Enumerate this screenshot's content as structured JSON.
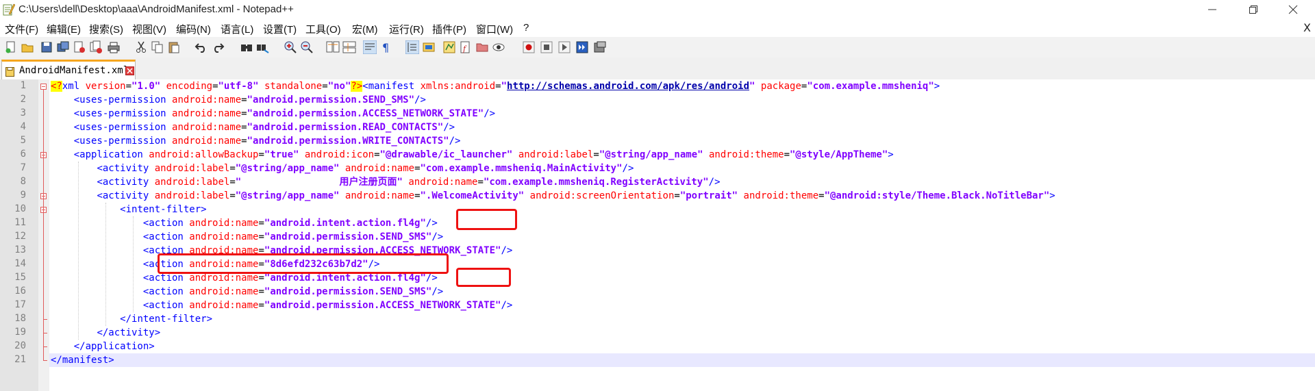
{
  "window": {
    "title": "C:\\Users\\dell\\Desktop\\aaa\\AndroidManifest.xml - Notepad++",
    "app_icon": "notepad-plus-icon"
  },
  "window_controls": [
    "minimize-icon",
    "restore-icon",
    "close-icon"
  ],
  "menu": {
    "items": [
      "文件(F)",
      "编辑(E)",
      "搜索(S)",
      "视图(V)",
      "编码(N)",
      "语言(L)",
      "设置(T)",
      "工具(O)",
      "宏(M)",
      "运行(R)",
      "插件(P)",
      "窗口(W)",
      "?"
    ],
    "close_label": "X"
  },
  "toolbar": {
    "icons": [
      "new-file-icon",
      "open-file-icon",
      "save-icon",
      "save-all-icon",
      "close-icon",
      "close-all-icon",
      "print-icon",
      "cut-icon",
      "copy-icon",
      "paste-icon",
      "undo-icon",
      "redo-icon",
      "find-icon",
      "replace-icon",
      "zoom-in-icon",
      "zoom-out-icon",
      "sync-vertical-icon",
      "sync-horizontal-icon",
      "word-wrap-icon",
      "show-all-chars-icon",
      "indent-guide-icon",
      "user-language-icon",
      "doc-map-icon",
      "function-list-icon",
      "folder-workspace-icon",
      "monitoring-icon",
      "record-macro-icon",
      "stop-macro-icon",
      "play-macro-icon",
      "run-macro-multiple-icon",
      "save-macro-icon"
    ]
  },
  "tab": {
    "label": "AndroidManifest.xml",
    "modified": true,
    "active": true
  },
  "editor": {
    "line_numbers": [
      "1",
      "2",
      "3",
      "4",
      "5",
      "6",
      "7",
      "8",
      "9",
      "10",
      "11",
      "12",
      "13",
      "14",
      "15",
      "16",
      "17",
      "18",
      "19",
      "20",
      "21"
    ],
    "current_line": 21,
    "lines": [
      [
        [
          "pi",
          "<?"
        ],
        [
          "b",
          "xml "
        ],
        [
          "a",
          "version"
        ],
        [
          "m",
          "="
        ],
        [
          "v",
          "\"1.0\""
        ],
        [
          "m",
          " "
        ],
        [
          "a",
          "encoding"
        ],
        [
          "m",
          "="
        ],
        [
          "v",
          "\"utf-8\""
        ],
        [
          "m",
          " "
        ],
        [
          "a",
          "standalone"
        ],
        [
          "m",
          "="
        ],
        [
          "v",
          "\"no\""
        ],
        [
          "pi",
          "?>"
        ],
        [
          "b",
          "<manifest "
        ],
        [
          "a",
          "xmlns:android"
        ],
        [
          "m",
          "="
        ],
        [
          "v",
          "\""
        ],
        [
          "u",
          "http://schemas.android.com/apk/res/android"
        ],
        [
          "v",
          "\""
        ],
        [
          "m",
          " "
        ],
        [
          "a",
          "package"
        ],
        [
          "m",
          "="
        ],
        [
          "v",
          "\"com.example.mmsheniq\""
        ],
        [
          "b",
          ">"
        ]
      ],
      [
        [
          "m",
          "    "
        ],
        [
          "b",
          "<uses-permission "
        ],
        [
          "a",
          "android:name"
        ],
        [
          "m",
          "="
        ],
        [
          "v",
          "\"android.permission.SEND_SMS\""
        ],
        [
          "b",
          "/>"
        ]
      ],
      [
        [
          "m",
          "    "
        ],
        [
          "b",
          "<uses-permission "
        ],
        [
          "a",
          "android:name"
        ],
        [
          "m",
          "="
        ],
        [
          "v",
          "\"android.permission.ACCESS_NETWORK_STATE\""
        ],
        [
          "b",
          "/>"
        ]
      ],
      [
        [
          "m",
          "    "
        ],
        [
          "b",
          "<uses-permission "
        ],
        [
          "a",
          "android:name"
        ],
        [
          "m",
          "="
        ],
        [
          "v",
          "\"android.permission.READ_CONTACTS\""
        ],
        [
          "b",
          "/>"
        ]
      ],
      [
        [
          "m",
          "    "
        ],
        [
          "b",
          "<uses-permission "
        ],
        [
          "a",
          "android:name"
        ],
        [
          "m",
          "="
        ],
        [
          "v",
          "\"android.permission.WRITE_CONTACTS\""
        ],
        [
          "b",
          "/>"
        ]
      ],
      [
        [
          "m",
          "    "
        ],
        [
          "b",
          "<application "
        ],
        [
          "a",
          "android:allowBackup"
        ],
        [
          "m",
          "="
        ],
        [
          "v",
          "\"true\""
        ],
        [
          "m",
          " "
        ],
        [
          "a",
          "android:icon"
        ],
        [
          "m",
          "="
        ],
        [
          "v",
          "\"@drawable/ic_launcher\""
        ],
        [
          "m",
          " "
        ],
        [
          "a",
          "android:label"
        ],
        [
          "m",
          "="
        ],
        [
          "v",
          "\"@string/app_name\""
        ],
        [
          "m",
          " "
        ],
        [
          "a",
          "android:theme"
        ],
        [
          "m",
          "="
        ],
        [
          "v",
          "\"@style/AppTheme\""
        ],
        [
          "b",
          ">"
        ]
      ],
      [
        [
          "m",
          "        "
        ],
        [
          "b",
          "<activity "
        ],
        [
          "a",
          "android:label"
        ],
        [
          "m",
          "="
        ],
        [
          "v",
          "\"@string/app_name\""
        ],
        [
          "m",
          " "
        ],
        [
          "a",
          "android:name"
        ],
        [
          "m",
          "="
        ],
        [
          "v",
          "\"com.example.mmsheniq.MainActivity\""
        ],
        [
          "b",
          "/>"
        ]
      ],
      [
        [
          "m",
          "        "
        ],
        [
          "b",
          "<activity "
        ],
        [
          "a",
          "android:label"
        ],
        [
          "m",
          "="
        ],
        [
          "v",
          "\"                 "
        ],
        [
          "t",
          "用户注册页面"
        ],
        [
          "v",
          "\""
        ],
        [
          "m",
          " "
        ],
        [
          "a",
          "android:name"
        ],
        [
          "m",
          "="
        ],
        [
          "v",
          "\"com.example.mmsheniq.RegisterActivity\""
        ],
        [
          "b",
          "/>"
        ]
      ],
      [
        [
          "m",
          "        "
        ],
        [
          "b",
          "<activity "
        ],
        [
          "a",
          "android:label"
        ],
        [
          "m",
          "="
        ],
        [
          "v",
          "\"@string/app_name\""
        ],
        [
          "m",
          " "
        ],
        [
          "a",
          "android:name"
        ],
        [
          "m",
          "="
        ],
        [
          "v",
          "\".WelcomeActivity\""
        ],
        [
          "m",
          " "
        ],
        [
          "a",
          "android:screenOrientation"
        ],
        [
          "m",
          "="
        ],
        [
          "v",
          "\"portrait\""
        ],
        [
          "m",
          " "
        ],
        [
          "a",
          "android:theme"
        ],
        [
          "m",
          "="
        ],
        [
          "v",
          "\"@android:style/Theme.Black.NoTitleBar\""
        ],
        [
          "b",
          ">"
        ]
      ],
      [
        [
          "m",
          "            "
        ],
        [
          "b",
          "<intent-filter>"
        ]
      ],
      [
        [
          "m",
          "                "
        ],
        [
          "b",
          "<action "
        ],
        [
          "a",
          "android:name"
        ],
        [
          "m",
          "="
        ],
        [
          "v",
          "\"android.intent.action.fl4g\""
        ],
        [
          "b",
          "/>"
        ]
      ],
      [
        [
          "m",
          "                "
        ],
        [
          "b",
          "<action "
        ],
        [
          "a",
          "android:name"
        ],
        [
          "m",
          "="
        ],
        [
          "v",
          "\"android.permission.SEND_SMS\""
        ],
        [
          "b",
          "/>"
        ]
      ],
      [
        [
          "m",
          "                "
        ],
        [
          "b",
          "<action "
        ],
        [
          "a",
          "android:name"
        ],
        [
          "m",
          "="
        ],
        [
          "v",
          "\"android.permission.ACCESS_NETWORK_STATE\""
        ],
        [
          "b",
          "/>"
        ]
      ],
      [
        [
          "m",
          "                "
        ],
        [
          "b",
          "<action "
        ],
        [
          "a",
          "android:name"
        ],
        [
          "m",
          "="
        ],
        [
          "v",
          "\"8d6efd232c63b7d2\""
        ],
        [
          "b",
          "/>"
        ]
      ],
      [
        [
          "m",
          "                "
        ],
        [
          "b",
          "<action "
        ],
        [
          "a",
          "android:name"
        ],
        [
          "m",
          "="
        ],
        [
          "v",
          "\"android.intent.action.fl4g\""
        ],
        [
          "b",
          "/>"
        ]
      ],
      [
        [
          "m",
          "                "
        ],
        [
          "b",
          "<action "
        ],
        [
          "a",
          "android:name"
        ],
        [
          "m",
          "="
        ],
        [
          "v",
          "\"android.permission.SEND_SMS\""
        ],
        [
          "b",
          "/>"
        ]
      ],
      [
        [
          "m",
          "                "
        ],
        [
          "b",
          "<action "
        ],
        [
          "a",
          "android:name"
        ],
        [
          "m",
          "="
        ],
        [
          "v",
          "\"android.permission.ACCESS_NETWORK_STATE\""
        ],
        [
          "b",
          "/>"
        ]
      ],
      [
        [
          "m",
          "            "
        ],
        [
          "b",
          "</intent-filter>"
        ]
      ],
      [
        [
          "m",
          "        "
        ],
        [
          "b",
          "</activity>"
        ]
      ],
      [
        [
          "m",
          "    "
        ],
        [
          "b",
          "</application>"
        ]
      ],
      [
        [
          "b",
          "</manifest>"
        ]
      ]
    ]
  },
  "colors": {
    "tag": "#0000ff",
    "attribute": "#ff0000",
    "value": "#8000ff",
    "annotation": "#ee1111",
    "tab_accent": "#f6a61e"
  }
}
